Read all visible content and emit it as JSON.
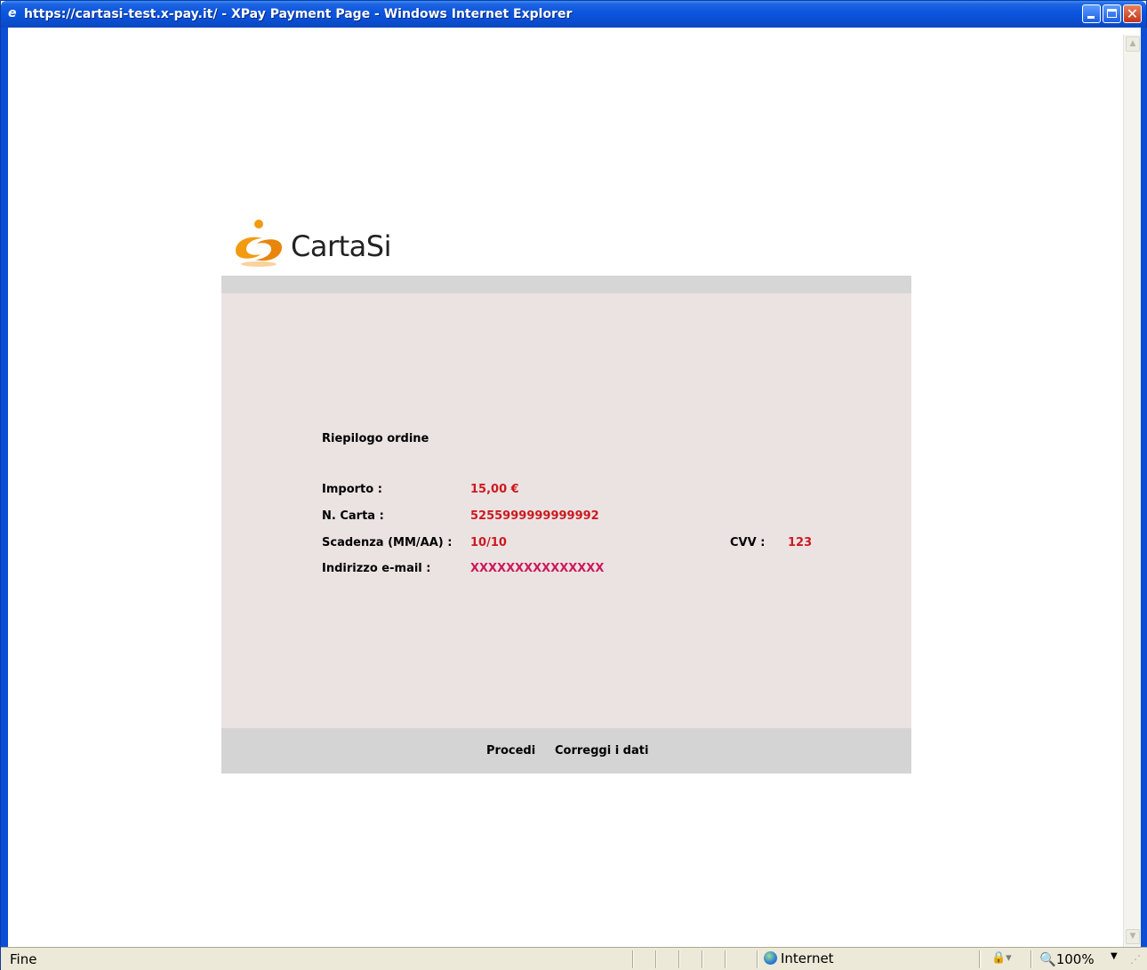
{
  "window": {
    "title": "https://cartasi-test.x-pay.it/ - XPay Payment Page - Windows Internet Explorer",
    "ie_icon": "e",
    "close_glyph": "✕"
  },
  "page": {
    "logo_text": "CartaSi",
    "summary_title": "Riepilogo ordine",
    "fields": {
      "amount_label": "Importo :",
      "amount_value": "15,00  €",
      "card_label": "N. Carta :",
      "card_value": "5255999999999992",
      "expiry_label": "Scadenza (MM/AA) :",
      "expiry_value": "10/10",
      "cvv_label": "CVV :",
      "cvv_value": "123",
      "email_label": "Indirizzo e-mail :",
      "email_value": "XXXXXXXXXXXXXXX"
    },
    "actions": {
      "proceed": "Procedi",
      "correct": "Correggi i dati"
    }
  },
  "statusbar": {
    "status": "Fine",
    "zone": "Internet",
    "zoom": "100%"
  },
  "colors": {
    "panel_bg": "#ebe3e2",
    "panel_bars": "#d4d4d4",
    "value_red": "#cc1a20",
    "logo_orange": "#f29a10"
  }
}
